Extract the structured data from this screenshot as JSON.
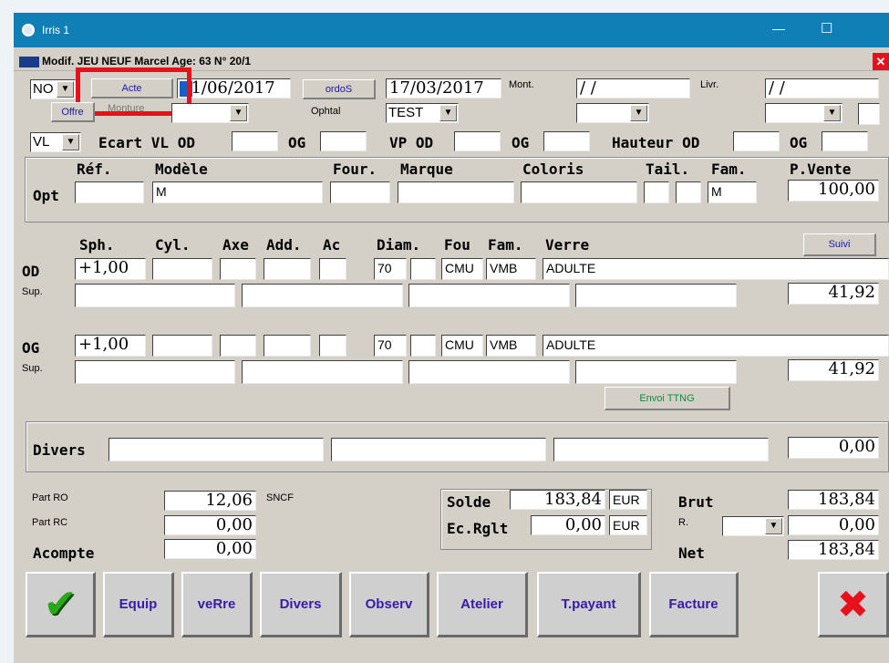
{
  "window": {
    "title": "Irris 1",
    "minimize": "—",
    "maximize": "☐"
  },
  "form": {
    "title": "Modif. JEU NEUF Marcel Age: 63 N° 20/1",
    "close": "✕"
  },
  "top": {
    "combo_no": "NO",
    "acte_label": "Acte",
    "date1": "21/06/2017",
    "ordos_label": "ordoS",
    "date2": "17/03/2017",
    "mont_label": "Mont.",
    "mont_value": "/    /",
    "livr_label": "Livr.",
    "livr_value": "/    /",
    "offre_label": "Offre",
    "monture_label": "Monture",
    "ophtal_label": "Ophtal",
    "test_value": "TEST",
    "vl_value": "VL",
    "ecart_label": "Ecart VL OD",
    "og_label": "OG",
    "vp_label": "VP OD",
    "og2_label": "OG",
    "hauteur_label": "Hauteur OD",
    "og3_label": "OG"
  },
  "opt": {
    "row_label": "Opt",
    "headers": {
      "ref": "Réf.",
      "modele": "Modèle",
      "four": "Four.",
      "marque": "Marque",
      "coloris": "Coloris",
      "tail": "Tail.",
      "fam": "Fam.",
      "pvente": "P.Vente"
    },
    "modele": "M",
    "fam": "M",
    "pvente": "100,00"
  },
  "lens": {
    "headers": {
      "sph": "Sph.",
      "cyl": "Cyl.",
      "axe": "Axe",
      "add": "Add.",
      "ac": "Ac",
      "diam": "Diam.",
      "fou": "Fou",
      "fam": "Fam.",
      "verre": "Verre"
    },
    "suivi_label": "Suivi",
    "od": {
      "label": "OD",
      "sup_label": "Sup.",
      "sph": "+1,00",
      "diam": "70",
      "fou": "CMU",
      "fam": "VMB",
      "verre": "ADULTE",
      "price": "41,92"
    },
    "og": {
      "label": "OG",
      "sup_label": "Sup.",
      "sph": "+1,00",
      "diam": "70",
      "fou": "CMU",
      "fam": "VMB",
      "verre": "ADULTE",
      "price": "41,92"
    },
    "envoi_label": "Envoi TTNG"
  },
  "divers": {
    "label": "Divers",
    "value": "0,00"
  },
  "totals": {
    "part_ro_label": "Part RO",
    "part_ro": "12,06",
    "sncf": "SNCF",
    "part_rc_label": "Part RC",
    "part_rc": "0,00",
    "acompte_label": "Acompte",
    "acompte": "0,00",
    "solde_label": "Solde",
    "solde": "183,84",
    "solde_cur": "EUR",
    "ecrglt_label": "Ec.Rglt",
    "ecrglt": "0,00",
    "ecrglt_cur": "EUR",
    "brut_label": "Brut",
    "brut": "183,84",
    "r_label": "R.",
    "r_value": "0,00",
    "net_label": "Net",
    "net": "183,84"
  },
  "buttons": [
    "Equip",
    "veRre",
    "Divers",
    "Observ",
    "Atelier",
    "T.payant",
    "Facture"
  ],
  "colors": {
    "titlebar": "#0f7fb6",
    "highlight": "#e8101a",
    "form_bg": "#d4d0c8",
    "button_text": "#3a1aa8"
  }
}
